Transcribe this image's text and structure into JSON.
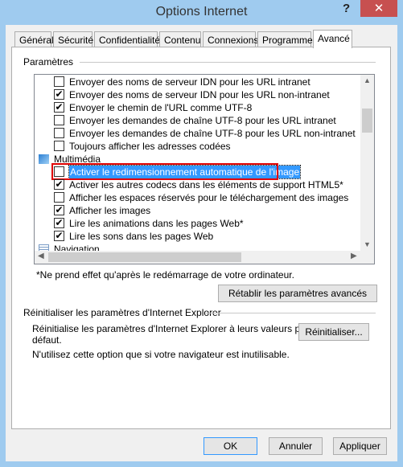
{
  "window": {
    "title": "Options Internet",
    "help": "?",
    "close": "✕"
  },
  "tabs": [
    "Général",
    "Sécurité",
    "Confidentialité",
    "Contenu",
    "Connexions",
    "Programmes",
    "Avancé"
  ],
  "active_tab": "Avancé",
  "settings": {
    "label": "Paramètres",
    "items": [
      {
        "type": "check",
        "label": "Envoyer des noms de serveur IDN pour les URL intranet",
        "checked": false
      },
      {
        "type": "check",
        "label": "Envoyer des noms de serveur IDN pour les URL non-intranet",
        "checked": true
      },
      {
        "type": "check",
        "label": "Envoyer le chemin de l'URL comme UTF-8",
        "checked": true
      },
      {
        "type": "check",
        "label": "Envoyer les demandes de chaîne UTF-8 pour les URL intranet",
        "checked": false
      },
      {
        "type": "check",
        "label": "Envoyer les demandes de chaîne UTF-8 pour les URL non-intranet",
        "checked": false
      },
      {
        "type": "check",
        "label": "Toujours afficher les adresses codées",
        "checked": false
      },
      {
        "type": "category",
        "label": "Multimédia",
        "icon": "multimedia-icon"
      },
      {
        "type": "check",
        "label": "Activer le redimensionnement automatique de l'image",
        "checked": false,
        "selected": true
      },
      {
        "type": "check",
        "label": "Activer les autres codecs dans les éléments de support HTML5*",
        "checked": true
      },
      {
        "type": "check",
        "label": "Afficher les espaces réservés pour le téléchargement des images",
        "checked": false
      },
      {
        "type": "check",
        "label": "Afficher les images",
        "checked": true
      },
      {
        "type": "check",
        "label": "Lire les animations dans les pages Web*",
        "checked": true
      },
      {
        "type": "check",
        "label": "Lire les sons dans les pages Web",
        "checked": true
      },
      {
        "type": "category",
        "label": "Navigation",
        "icon": "navigation-icon"
      }
    ],
    "note": "*Ne prend effet qu'après le redémarrage de votre ordinateur.",
    "restore_button": "Rétablir les paramètres avancés"
  },
  "reset": {
    "label": "Réinitialiser les paramètres d'Internet Explorer",
    "description_1": "Réinitialise les paramètres d'Internet Explorer à leurs valeurs par",
    "description_2": "défaut.",
    "button": "Réinitialiser...",
    "warning": "N'utilisez cette option que si votre navigateur est inutilisable."
  },
  "buttons": {
    "ok": "OK",
    "cancel": "Annuler",
    "apply": "Appliquer"
  }
}
